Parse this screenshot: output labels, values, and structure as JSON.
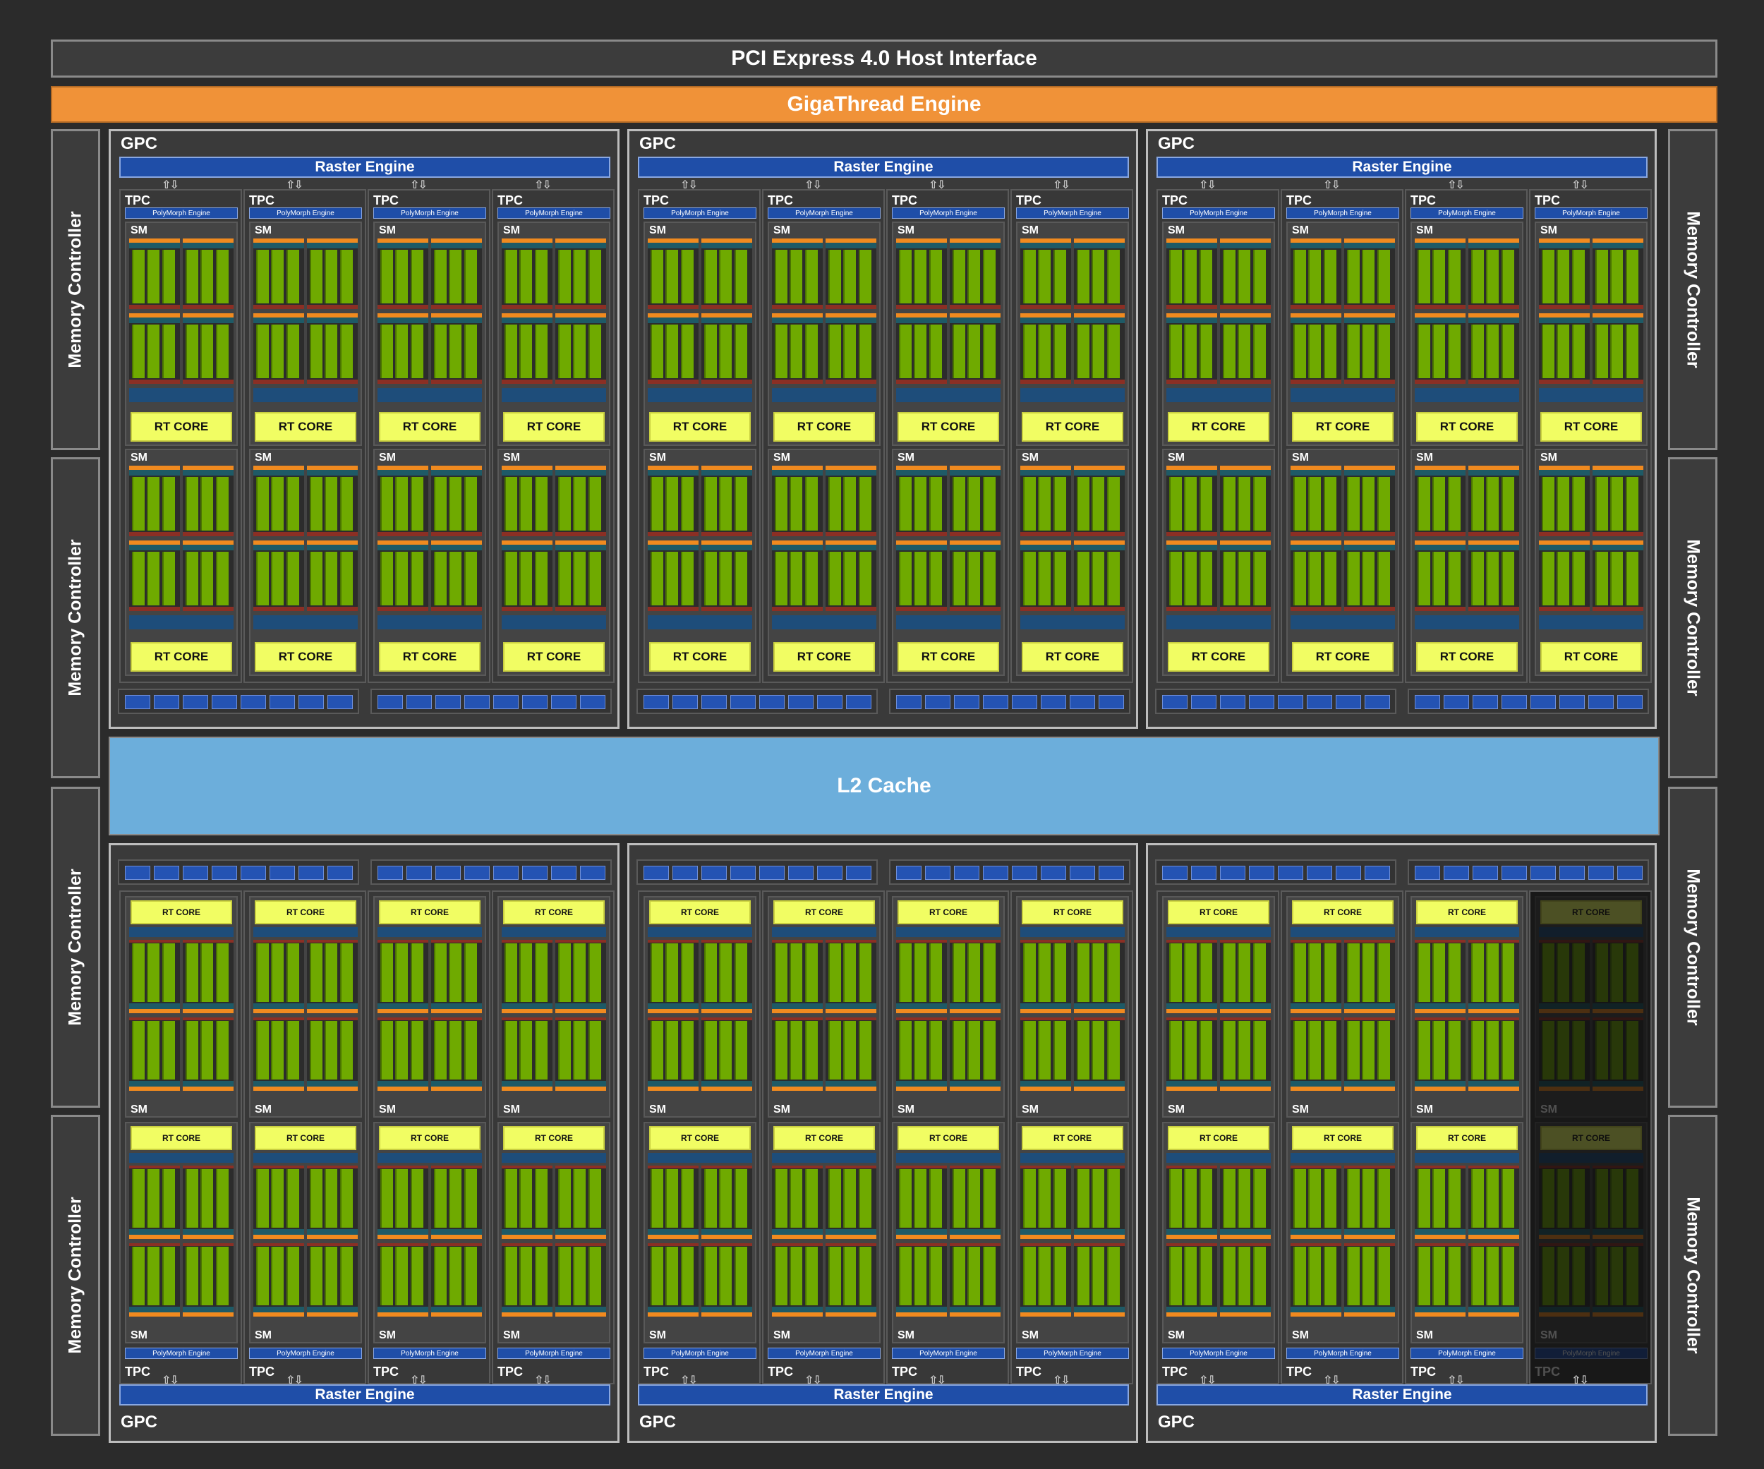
{
  "pcie": "PCI Express 4.0 Host Interface",
  "gigathread": "GigaThread Engine",
  "l2": "L2 Cache",
  "memory_controller": "Memory Controller",
  "gpc": "GPC",
  "raster_engine": "Raster Engine",
  "tpc": "TPC",
  "polymorph_engine": "PolyMorph Engine",
  "sm": "SM",
  "rt_core": "RT CORE",
  "colors": {
    "background": "#2b2b2b",
    "gigathread": "#f09238",
    "l2": "#6caedb",
    "raster": "#1f4ea8",
    "rt_core": "#f1fd63",
    "cuda": "#6faa00",
    "tensor_strip": "#1e5a66",
    "l1": "#f08a1f",
    "register": "#8b2f24"
  },
  "layout": {
    "gpc_rows": 2,
    "gpc_columns": 3,
    "tpcs_per_gpc": 4,
    "sms_per_tpc": 2,
    "disabled_tpcs": [
      "bottom-right-gpc/tpc-4"
    ]
  }
}
